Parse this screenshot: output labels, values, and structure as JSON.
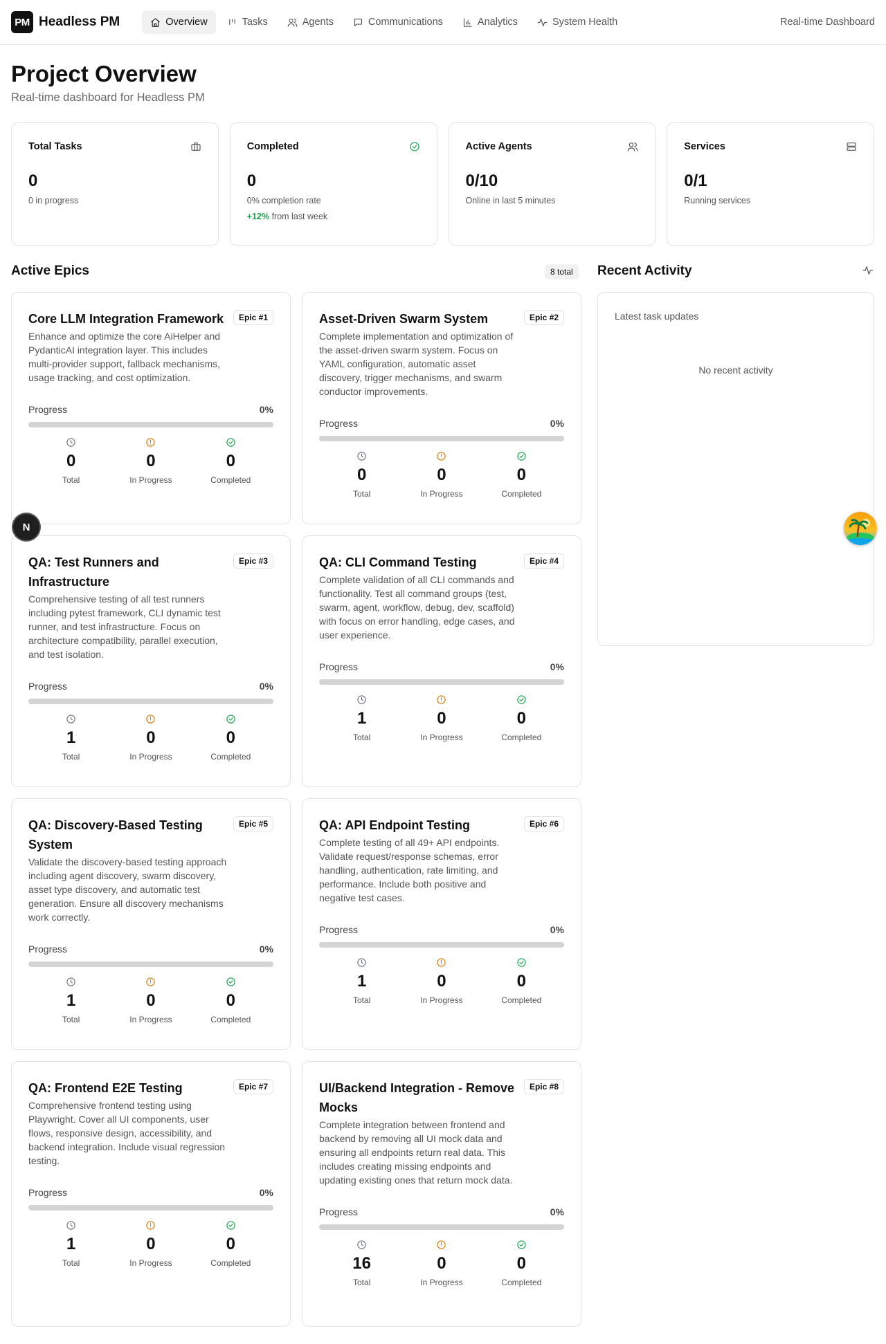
{
  "brand": {
    "logo": "PM",
    "name": "Headless PM"
  },
  "nav": {
    "items": [
      {
        "label": "Overview",
        "icon": "home-icon",
        "active": true
      },
      {
        "label": "Tasks",
        "icon": "kanban-icon"
      },
      {
        "label": "Agents",
        "icon": "users-icon"
      },
      {
        "label": "Communications",
        "icon": "message-icon"
      },
      {
        "label": "Analytics",
        "icon": "bar-chart-icon"
      },
      {
        "label": "System Health",
        "icon": "activity-icon"
      }
    ],
    "right_label": "Real-time Dashboard"
  },
  "page": {
    "title": "Project Overview",
    "subtitle": "Real-time dashboard for Headless PM"
  },
  "stats": [
    {
      "label": "Total Tasks",
      "value": "0",
      "sub": "0 in progress",
      "icon": "briefcase-icon"
    },
    {
      "label": "Completed",
      "value": "0",
      "sub": "0% completion rate",
      "delta": "+12%",
      "delta_text": "from last week",
      "icon": "check-circle-icon"
    },
    {
      "label": "Active Agents",
      "value": "0/10",
      "sub": "Online in last 5 minutes",
      "icon": "users-icon"
    },
    {
      "label": "Services",
      "value": "0/1",
      "sub": "Running services",
      "icon": "server-icon"
    }
  ],
  "epics_section": {
    "title": "Active Epics",
    "total_badge": "8 total"
  },
  "epic_stat_labels": {
    "total": "Total",
    "in_progress": "In Progress",
    "completed": "Completed",
    "progress": "Progress"
  },
  "epics": [
    {
      "title": "Core LLM Integration Framework",
      "badge": "Epic #1",
      "description": "Enhance and optimize the core AiHelper and PydanticAI integration layer. This includes multi-provider support, fallback mechanisms, usage tracking, and cost optimization.",
      "progress": "0%",
      "progress_value": 0,
      "total": "0",
      "in_progress": "0",
      "completed": "0"
    },
    {
      "title": "Asset-Driven Swarm System",
      "badge": "Epic #2",
      "description": "Complete implementation and optimization of the asset-driven swarm system. Focus on YAML configuration, automatic asset discovery, trigger mechanisms, and swarm conductor improvements.",
      "progress": "0%",
      "progress_value": 0,
      "total": "0",
      "in_progress": "0",
      "completed": "0"
    },
    {
      "title": "QA: Test Runners and Infrastructure",
      "badge": "Epic #3",
      "description": "Comprehensive testing of all test runners including pytest framework, CLI dynamic test runner, and test infrastructure. Focus on architecture compatibility, parallel execution, and test isolation.",
      "progress": "0%",
      "progress_value": 0,
      "total": "1",
      "in_progress": "0",
      "completed": "0"
    },
    {
      "title": "QA: CLI Command Testing",
      "badge": "Epic #4",
      "description": "Complete validation of all CLI commands and functionality. Test all command groups (test, swarm, agent, workflow, debug, dev, scaffold) with focus on error handling, edge cases, and user experience.",
      "progress": "0%",
      "progress_value": 0,
      "total": "1",
      "in_progress": "0",
      "completed": "0"
    },
    {
      "title": "QA: Discovery-Based Testing System",
      "badge": "Epic #5",
      "description": "Validate the discovery-based testing approach including agent discovery, swarm discovery, asset type discovery, and automatic test generation. Ensure all discovery mechanisms work correctly.",
      "progress": "0%",
      "progress_value": 0,
      "total": "1",
      "in_progress": "0",
      "completed": "0"
    },
    {
      "title": "QA: API Endpoint Testing",
      "badge": "Epic #6",
      "description": "Complete testing of all 49+ API endpoints. Validate request/response schemas, error handling, authentication, rate limiting, and performance. Include both positive and negative test cases.",
      "progress": "0%",
      "progress_value": 0,
      "total": "1",
      "in_progress": "0",
      "completed": "0"
    },
    {
      "title": "QA: Frontend E2E Testing",
      "badge": "Epic #7",
      "description": "Comprehensive frontend testing using Playwright. Cover all UI components, user flows, responsive design, accessibility, and backend integration. Include visual regression testing.",
      "progress": "0%",
      "progress_value": 0,
      "total": "1",
      "in_progress": "0",
      "completed": "0"
    },
    {
      "title": "UI/Backend Integration - Remove Mocks",
      "badge": "Epic #8",
      "description": "Complete integration between frontend and backend by removing all UI mock data and ensuring all endpoints return real data. This includes creating missing endpoints and updating existing ones that return mock data.",
      "progress": "0%",
      "progress_value": 0,
      "total": "16",
      "in_progress": "0",
      "completed": "0"
    }
  ],
  "activity": {
    "title": "Recent Activity",
    "subtitle": "Latest task updates",
    "empty": "No recent activity",
    "icon": "activity-icon"
  },
  "floating": {
    "dev_badge": "N"
  },
  "colors": {
    "success": "#16a34a",
    "warning": "#d97706",
    "muted": "#6b7280",
    "track": "#d4d4d4"
  }
}
